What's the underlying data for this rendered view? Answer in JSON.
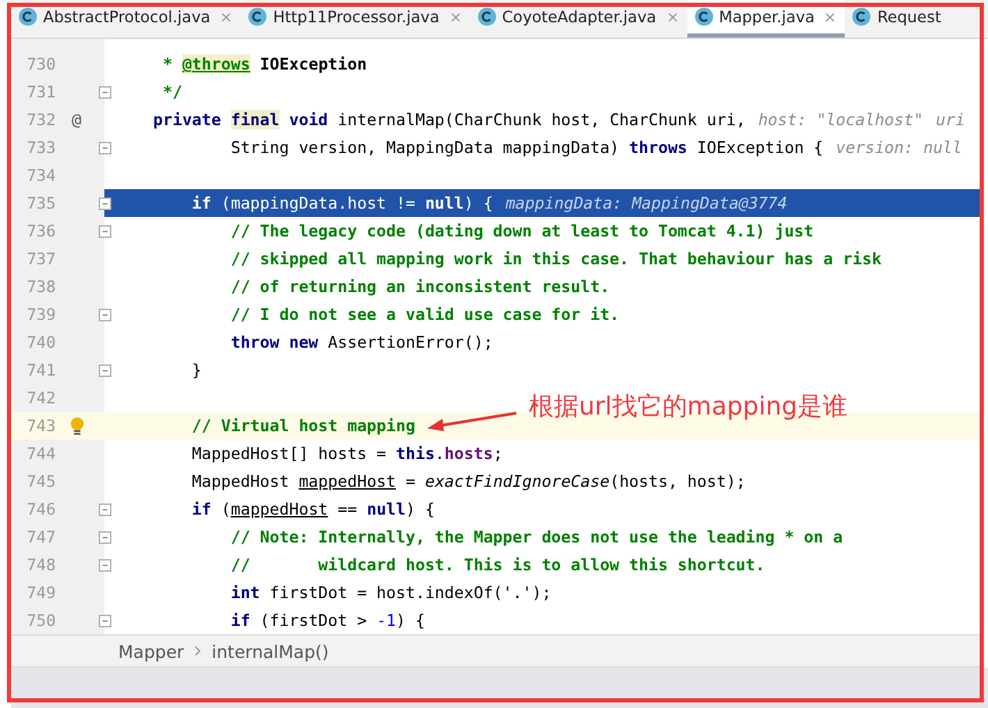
{
  "tabs": [
    {
      "label": "AbstractProtocol.java",
      "selected": false,
      "closable": true
    },
    {
      "label": "Http11Processor.java",
      "selected": false,
      "closable": true
    },
    {
      "label": "CoyoteAdapter.java",
      "selected": false,
      "closable": true
    },
    {
      "label": "Mapper.java",
      "selected": true,
      "closable": true
    },
    {
      "label": "Request",
      "selected": false,
      "closable": false
    }
  ],
  "editor": {
    "lines": [
      {
        "number": "730",
        "fold": false,
        "bulb": false,
        "selected": false,
        "current": false,
        "tokens": [
          {
            "text": " * ",
            "kind": "comment"
          },
          {
            "text": "@throws",
            "kind": "doctag"
          },
          {
            "text": " IOException",
            "kind": "docref"
          }
        ]
      },
      {
        "number": "731",
        "fold": true,
        "bulb": false,
        "selected": false,
        "current": false,
        "tokens": [
          {
            "text": " */",
            "kind": "comment"
          }
        ]
      },
      {
        "number": "732",
        "marker": "@",
        "fold": false,
        "bulb": false,
        "selected": false,
        "current": false,
        "tokens": [
          {
            "text": "private ",
            "kind": "keyword"
          },
          {
            "text": "final",
            "kind": "marked"
          },
          {
            "text": " void",
            "kind": "keyword"
          },
          {
            "text": " internalMap(CharChunk host, CharChunk uri,",
            "kind": "plain"
          }
        ],
        "hints": [
          "host: \"localhost\"",
          "uri"
        ]
      },
      {
        "number": "733",
        "fold": true,
        "bulb": false,
        "selected": false,
        "current": false,
        "tokens": [
          {
            "text": "        String version, MappingData mappingData) ",
            "kind": "plain"
          },
          {
            "text": "throws",
            "kind": "keyword"
          },
          {
            "text": " IOException {",
            "kind": "plain"
          }
        ],
        "hints": [
          "version: null"
        ]
      },
      {
        "number": "734",
        "fold": false,
        "bulb": false,
        "selected": false,
        "current": false
      },
      {
        "number": "735",
        "fold": true,
        "bulb": false,
        "selected": true,
        "current": false,
        "tokens": [
          {
            "text": "    if",
            "kind": "keyword"
          },
          {
            "text": " (mappingData.host != ",
            "kind": "plain"
          },
          {
            "text": "null",
            "kind": "keyword"
          },
          {
            "text": ") {",
            "kind": "plain"
          }
        ],
        "hints": [
          "mappingData: MappingData@3774"
        ]
      },
      {
        "number": "736",
        "fold": true,
        "bulb": false,
        "selected": false,
        "current": false,
        "tokens": [
          {
            "text": "        // The legacy code (dating down at least to Tomcat 4.1) just",
            "kind": "comment"
          }
        ]
      },
      {
        "number": "737",
        "fold": false,
        "bulb": false,
        "selected": false,
        "current": false,
        "tokens": [
          {
            "text": "        // skipped all mapping work in this case. That behaviour has a risk",
            "kind": "comment"
          }
        ]
      },
      {
        "number": "738",
        "fold": false,
        "bulb": false,
        "selected": false,
        "current": false,
        "tokens": [
          {
            "text": "        // of returning an inconsistent result.",
            "kind": "comment"
          }
        ]
      },
      {
        "number": "739",
        "fold": true,
        "bulb": false,
        "selected": false,
        "current": false,
        "tokens": [
          {
            "text": "        // I do not see a valid use case for it.",
            "kind": "comment"
          }
        ]
      },
      {
        "number": "740",
        "fold": false,
        "bulb": false,
        "selected": false,
        "current": false,
        "tokens": [
          {
            "text": "        throw new",
            "kind": "keyword"
          },
          {
            "text": " AssertionError();",
            "kind": "plain"
          }
        ]
      },
      {
        "number": "741",
        "fold": true,
        "bulb": false,
        "selected": false,
        "current": false,
        "tokens": [
          {
            "text": "    }",
            "kind": "plain"
          }
        ]
      },
      {
        "number": "742",
        "fold": false,
        "bulb": false,
        "selected": false,
        "current": false
      },
      {
        "number": "743",
        "fold": false,
        "bulb": true,
        "selected": false,
        "current": true,
        "tokens": [
          {
            "text": "    // Virtual host mapping",
            "kind": "comment"
          }
        ]
      },
      {
        "number": "744",
        "fold": false,
        "bulb": false,
        "selected": false,
        "current": false,
        "tokens": [
          {
            "text": "    MappedHost[] hosts = ",
            "kind": "plain"
          },
          {
            "text": "this",
            "kind": "keyword"
          },
          {
            "text": ".",
            "kind": "plain"
          },
          {
            "text": "hosts",
            "kind": "field"
          },
          {
            "text": ";",
            "kind": "plain"
          }
        ]
      },
      {
        "number": "745",
        "fold": false,
        "bulb": false,
        "selected": false,
        "current": false,
        "tokens": [
          {
            "text": "    MappedHost ",
            "kind": "plain"
          },
          {
            "text": "mappedHost",
            "kind": "variable"
          },
          {
            "text": " = ",
            "kind": "plain"
          },
          {
            "text": "exactFindIgnoreCase",
            "kind": "static"
          },
          {
            "text": "(hosts, host);",
            "kind": "plain"
          }
        ]
      },
      {
        "number": "746",
        "fold": true,
        "bulb": false,
        "selected": false,
        "current": false,
        "tokens": [
          {
            "text": "    if",
            "kind": "keyword"
          },
          {
            "text": " (",
            "kind": "plain"
          },
          {
            "text": "mappedHost",
            "kind": "variable"
          },
          {
            "text": " == ",
            "kind": "plain"
          },
          {
            "text": "null",
            "kind": "keyword"
          },
          {
            "text": ") {",
            "kind": "plain"
          }
        ]
      },
      {
        "number": "747",
        "fold": true,
        "bulb": false,
        "selected": false,
        "current": false,
        "tokens": [
          {
            "text": "        // Note: Internally, the Mapper does not use the leading * on a",
            "kind": "comment"
          }
        ]
      },
      {
        "number": "748",
        "fold": true,
        "bulb": false,
        "selected": false,
        "current": false,
        "tokens": [
          {
            "text": "        //       wildcard host. This is to allow this shortcut.",
            "kind": "comment"
          }
        ]
      },
      {
        "number": "749",
        "fold": false,
        "bulb": false,
        "selected": false,
        "current": false,
        "tokens": [
          {
            "text": "        int",
            "kind": "keyword"
          },
          {
            "text": " firstDot = host.indexOf('.');",
            "kind": "plain"
          }
        ]
      },
      {
        "number": "750",
        "fold": true,
        "bulb": false,
        "selected": false,
        "current": false,
        "tokens": [
          {
            "text": "        if",
            "kind": "keyword"
          },
          {
            "text": " (firstDot > ",
            "kind": "plain"
          },
          {
            "text": "-1",
            "kind": "number"
          },
          {
            "text": ") {",
            "kind": "plain"
          }
        ]
      }
    ]
  },
  "breadcrumb": [
    "Mapper",
    "internalMap()"
  ],
  "annotation": {
    "text": "根据url找它的mapping是谁"
  }
}
